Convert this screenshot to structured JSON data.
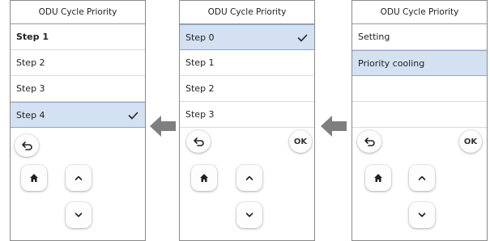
{
  "screens": [
    {
      "title": "ODU Cycle Priority",
      "rows": [
        {
          "label": "Step 1",
          "bold": true,
          "selected": false,
          "checked": false
        },
        {
          "label": "Step 2",
          "bold": false,
          "selected": false,
          "checked": false
        },
        {
          "label": "Step 3",
          "bold": false,
          "selected": false,
          "checked": false
        },
        {
          "label": "Step 4",
          "bold": false,
          "selected": true,
          "checked": true
        }
      ],
      "ok_visible": false
    },
    {
      "title": "ODU Cycle Priority",
      "rows": [
        {
          "label": "Step 0",
          "bold": false,
          "selected": true,
          "checked": true
        },
        {
          "label": "Step 1",
          "bold": false,
          "selected": false,
          "checked": false
        },
        {
          "label": "Step 2",
          "bold": false,
          "selected": false,
          "checked": false
        },
        {
          "label": "Step 3",
          "bold": false,
          "selected": false,
          "checked": false
        }
      ],
      "ok_visible": true,
      "ok_label": "OK"
    },
    {
      "title": "ODU Cycle Priority",
      "rows": [
        {
          "label": "Setting",
          "bold": false,
          "selected": false,
          "checked": false
        },
        {
          "label": "Priority cooling",
          "bold": false,
          "selected": true,
          "checked": false
        },
        {
          "label": "",
          "bold": false,
          "selected": false,
          "checked": false
        },
        {
          "label": "",
          "bold": false,
          "selected": false,
          "checked": false
        }
      ],
      "ok_visible": true,
      "ok_label": "OK"
    }
  ],
  "icons": {
    "back": "back-arrow-icon",
    "home": "home-icon",
    "up": "chevron-up-icon",
    "down": "chevron-down-icon",
    "check": "checkmark-icon",
    "flow_arrow": "left-arrow-icon"
  },
  "colors": {
    "selected_bg": "#d3e1f2",
    "selected_border": "#8aa8cd",
    "flow_arrow": "#7f7f7f"
  }
}
